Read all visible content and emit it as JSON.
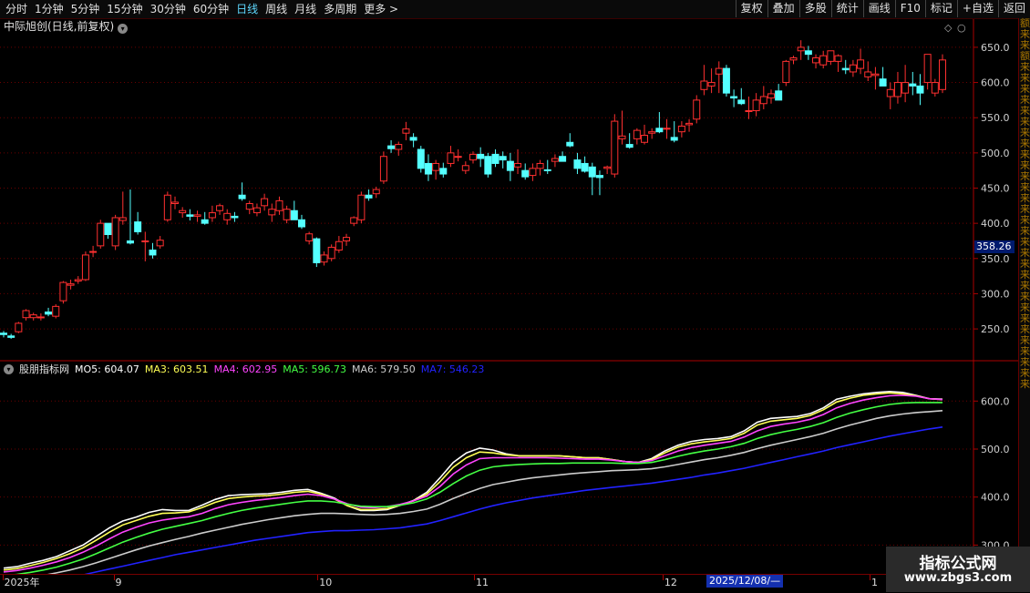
{
  "toolbar": {
    "periods": [
      "分时",
      "1分钟",
      "5分钟",
      "15分钟",
      "30分钟",
      "60分钟",
      "日线",
      "周线",
      "月线",
      "多周期",
      "更多 >"
    ],
    "active_period": "日线",
    "right_buttons": [
      "复权",
      "叠加",
      "多股",
      "统计",
      "画线",
      "F10",
      "标记",
      "+自选",
      "返回"
    ]
  },
  "chart_title": "中际旭创(日线,前复权)",
  "price_axis": {
    "ticks": [
      "650.0",
      "600.0",
      "550.0",
      "500.0",
      "450.0",
      "400.0",
      "350.0",
      "300.0",
      "250.0"
    ]
  },
  "current_price_label": "358.26",
  "indicator": {
    "name": "股朋指标网",
    "lines": [
      {
        "label": "MO5: 604.07",
        "color": "#ffffff"
      },
      {
        "label": "MA3: 603.51",
        "color": "#ffff55"
      },
      {
        "label": "MA4: 602.95",
        "color": "#ff44ff"
      },
      {
        "label": "MA5: 596.73",
        "color": "#44ff44"
      },
      {
        "label": "MA6: 579.50",
        "color": "#cccccc"
      },
      {
        "label": "MA7: 546.23",
        "color": "#2222ff"
      }
    ],
    "axis_ticks": [
      "600.0",
      "500.0",
      "400.0",
      "300.0"
    ],
    "axis_tick_values": [
      600,
      500,
      400,
      300
    ]
  },
  "side_strip_chars": [
    "额",
    "来",
    "来",
    "额",
    "来",
    "来",
    "来",
    "来",
    "来",
    "来",
    "来",
    "来",
    "来",
    "来",
    "来",
    "来",
    "来",
    "来",
    "来",
    "来",
    "来",
    "来",
    "来",
    "来",
    "来",
    "来",
    "来",
    "来",
    "来",
    "来",
    "来",
    "来",
    "来",
    "来"
  ],
  "date_axis": {
    "labels": [
      {
        "text": "2025年",
        "pos": 0.004
      },
      {
        "text": "9",
        "pos": 0.112
      },
      {
        "text": "10",
        "pos": 0.31
      },
      {
        "text": "11",
        "pos": 0.462
      },
      {
        "text": "12",
        "pos": 0.645
      },
      {
        "text": "1",
        "pos": 0.846
      }
    ],
    "selected_date": "2025/12/08/—"
  },
  "watermark": {
    "line1": "指标公式网",
    "line2": "www.zbgs3.com"
  },
  "colors": {
    "up": "#ff3030",
    "down": "#54ffff",
    "grid": "#6a0000",
    "axis": "#aa0000"
  },
  "chart_data": {
    "type": "candlestick",
    "y_range": [
      210,
      668
    ],
    "candles": [
      [
        244,
        247,
        238,
        242
      ],
      [
        240,
        243,
        236,
        238
      ],
      [
        246,
        260,
        244,
        258
      ],
      [
        266,
        278,
        262,
        276
      ],
      [
        266,
        273,
        262,
        270
      ],
      [
        266,
        272,
        262,
        267
      ],
      [
        274,
        280,
        268,
        271
      ],
      [
        268,
        285,
        265,
        282
      ],
      [
        290,
        318,
        286,
        316
      ],
      [
        312,
        320,
        306,
        314
      ],
      [
        318,
        325,
        314,
        320
      ],
      [
        320,
        360,
        318,
        355
      ],
      [
        360,
        368,
        352,
        360
      ],
      [
        368,
        405,
        364,
        400
      ],
      [
        400,
        390,
        378,
        384
      ],
      [
        368,
        412,
        362,
        408
      ],
      [
        404,
        445,
        398,
        408
      ],
      [
        375,
        448,
        370,
        372
      ],
      [
        402,
        416,
        384,
        388
      ],
      [
        375,
        388,
        346,
        375
      ],
      [
        362,
        372,
        350,
        355
      ],
      [
        368,
        382,
        364,
        376
      ],
      [
        405,
        445,
        402,
        440
      ],
      [
        428,
        438,
        420,
        430
      ],
      [
        415,
        423,
        408,
        418
      ],
      [
        412,
        420,
        404,
        410
      ],
      [
        410,
        418,
        402,
        412
      ],
      [
        405,
        416,
        398,
        400
      ],
      [
        408,
        425,
        402,
        415
      ],
      [
        418,
        428,
        412,
        425
      ],
      [
        405,
        420,
        398,
        414
      ],
      [
        410,
        416,
        402,
        408
      ],
      [
        440,
        458,
        432,
        435
      ],
      [
        420,
        432,
        413,
        428
      ],
      [
        415,
        428,
        410,
        422
      ],
      [
        425,
        442,
        418,
        435
      ],
      [
        412,
        428,
        402,
        420
      ],
      [
        418,
        438,
        412,
        432
      ],
      [
        405,
        425,
        400,
        420
      ],
      [
        418,
        432,
        410,
        405
      ],
      [
        405,
        412,
        392,
        395
      ],
      [
        375,
        388,
        370,
        385
      ],
      [
        378,
        380,
        338,
        344
      ],
      [
        345,
        360,
        340,
        355
      ],
      [
        350,
        370,
        346,
        366
      ],
      [
        362,
        382,
        358,
        374
      ],
      [
        375,
        385,
        368,
        380
      ],
      [
        400,
        410,
        396,
        408
      ],
      [
        405,
        445,
        400,
        440
      ],
      [
        440,
        448,
        432,
        436
      ],
      [
        442,
        452,
        436,
        448
      ],
      [
        460,
        502,
        456,
        495
      ],
      [
        510,
        518,
        500,
        506
      ],
      [
        505,
        516,
        496,
        512
      ],
      [
        528,
        544,
        518,
        534
      ],
      [
        522,
        528,
        508,
        518
      ],
      [
        505,
        510,
        472,
        478
      ],
      [
        485,
        498,
        460,
        470
      ],
      [
        475,
        490,
        462,
        485
      ],
      [
        478,
        486,
        465,
        470
      ],
      [
        485,
        510,
        480,
        500
      ],
      [
        495,
        505,
        488,
        495
      ],
      [
        475,
        488,
        470,
        482
      ],
      [
        490,
        502,
        485,
        498
      ],
      [
        498,
        508,
        480,
        492
      ],
      [
        495,
        500,
        465,
        470
      ],
      [
        498,
        505,
        480,
        485
      ],
      [
        495,
        502,
        478,
        490
      ],
      [
        488,
        500,
        460,
        475
      ],
      [
        480,
        505,
        470,
        485
      ],
      [
        475,
        485,
        462,
        466
      ],
      [
        468,
        485,
        460,
        478
      ],
      [
        478,
        490,
        468,
        485
      ],
      [
        476,
        490,
        470,
        475
      ],
      [
        488,
        498,
        480,
        492
      ],
      [
        495,
        502,
        488,
        488
      ],
      [
        515,
        528,
        508,
        510
      ],
      [
        490,
        500,
        470,
        478
      ],
      [
        485,
        495,
        472,
        474
      ],
      [
        480,
        486,
        440,
        466
      ],
      [
        468,
        475,
        440,
        465
      ],
      [
        478,
        482,
        470,
        480
      ],
      [
        470,
        555,
        465,
        545
      ],
      [
        520,
        560,
        512,
        524
      ],
      [
        512,
        528,
        506,
        508
      ],
      [
        520,
        535,
        512,
        532
      ],
      [
        515,
        540,
        512,
        525
      ],
      [
        528,
        535,
        520,
        530
      ],
      [
        535,
        558,
        528,
        530
      ],
      [
        535,
        548,
        520,
        535
      ],
      [
        522,
        545,
        515,
        518
      ],
      [
        530,
        545,
        522,
        538
      ],
      [
        540,
        548,
        530,
        542
      ],
      [
        548,
        582,
        542,
        575
      ],
      [
        590,
        625,
        582,
        602
      ],
      [
        595,
        620,
        585,
        600
      ],
      [
        612,
        630,
        585,
        620
      ],
      [
        620,
        625,
        580,
        585
      ],
      [
        580,
        590,
        565,
        578
      ],
      [
        575,
        592,
        568,
        570
      ],
      [
        560,
        580,
        548,
        560
      ],
      [
        560,
        585,
        552,
        575
      ],
      [
        570,
        595,
        562,
        580
      ],
      [
        578,
        590,
        570,
        584
      ],
      [
        588,
        598,
        580,
        575
      ],
      [
        600,
        632,
        595,
        630
      ],
      [
        632,
        638,
        626,
        635
      ],
      [
        645,
        660,
        632,
        650
      ],
      [
        645,
        652,
        632,
        640
      ],
      [
        628,
        640,
        620,
        635
      ],
      [
        625,
        645,
        620,
        638
      ],
      [
        630,
        645,
        625,
        645
      ],
      [
        630,
        640,
        615,
        638
      ],
      [
        620,
        632,
        612,
        618
      ],
      [
        615,
        632,
        608,
        625
      ],
      [
        620,
        648,
        612,
        632
      ],
      [
        608,
        630,
        602,
        615
      ],
      [
        610,
        622,
        590,
        612
      ],
      [
        605,
        622,
        595,
        595
      ],
      [
        580,
        600,
        562,
        590
      ],
      [
        580,
        615,
        570,
        600
      ],
      [
        585,
        625,
        572,
        600
      ],
      [
        598,
        615,
        582,
        595
      ],
      [
        595,
        612,
        568,
        585
      ],
      [
        600,
        638,
        590,
        640
      ],
      [
        585,
        605,
        580,
        600
      ],
      [
        590,
        640,
        585,
        632
      ]
    ],
    "indicator_y_range": [
      240,
      648
    ],
    "series": [
      {
        "name": "MO5",
        "color": "#ffffff",
        "values": [
          252,
          255,
          262,
          268,
          276,
          288,
          300,
          318,
          336,
          350,
          358,
          368,
          374,
          372,
          372,
          383,
          395,
          403,
          405,
          406,
          407,
          410,
          414,
          416,
          408,
          398,
          382,
          372,
          372,
          374,
          383,
          393,
          410,
          440,
          472,
          492,
          502,
          498,
          490,
          486,
          486,
          486,
          486,
          484,
          482,
          482,
          478,
          474,
          472,
          480,
          496,
          508,
          516,
          520,
          522,
          526,
          538,
          556,
          564,
          566,
          568,
          574,
          586,
          604,
          610,
          615,
          618,
          620,
          618,
          612,
          605,
          604
        ]
      },
      {
        "name": "MA3",
        "color": "#ffff55",
        "values": [
          248,
          251,
          257,
          264,
          272,
          282,
          294,
          310,
          327,
          342,
          351,
          360,
          366,
          367,
          369,
          378,
          389,
          397,
          400,
          402,
          403,
          406,
          410,
          412,
          406,
          396,
          382,
          374,
          374,
          376,
          383,
          392,
          406,
          432,
          462,
          482,
          494,
          492,
          488,
          486,
          486,
          486,
          486,
          484,
          482,
          482,
          478,
          474,
          472,
          478,
          492,
          504,
          511,
          515,
          518,
          522,
          533,
          550,
          558,
          561,
          564,
          570,
          582,
          598,
          606,
          612,
          615,
          617,
          615,
          611,
          605,
          603
        ]
      },
      {
        "name": "MA4",
        "color": "#ff44ff",
        "values": [
          244,
          247,
          252,
          258,
          265,
          274,
          285,
          298,
          313,
          327,
          337,
          346,
          352,
          356,
          359,
          366,
          376,
          384,
          389,
          393,
          396,
          399,
          403,
          406,
          403,
          396,
          386,
          379,
          378,
          380,
          385,
          392,
          402,
          422,
          448,
          467,
          480,
          482,
          482,
          482,
          482,
          482,
          481,
          480,
          479,
          479,
          477,
          474,
          472,
          476,
          486,
          496,
          503,
          508,
          512,
          516,
          525,
          538,
          547,
          552,
          556,
          562,
          572,
          586,
          595,
          602,
          607,
          611,
          612,
          610,
          605,
          603
        ]
      },
      {
        "name": "MA5",
        "color": "#44ff44",
        "values": [
          236,
          239,
          243,
          248,
          254,
          262,
          271,
          282,
          294,
          306,
          316,
          325,
          333,
          339,
          345,
          351,
          359,
          366,
          372,
          377,
          381,
          385,
          389,
          392,
          392,
          390,
          385,
          381,
          380,
          380,
          383,
          388,
          396,
          410,
          428,
          444,
          456,
          463,
          466,
          468,
          469,
          470,
          470,
          471,
          471,
          471,
          471,
          470,
          470,
          472,
          478,
          485,
          491,
          496,
          500,
          505,
          512,
          522,
          530,
          536,
          541,
          547,
          555,
          566,
          575,
          582,
          588,
          593,
          596,
          597,
          597,
          597
        ]
      },
      {
        "name": "MA6",
        "color": "#cccccc",
        "values": [
          228,
          230,
          233,
          237,
          242,
          248,
          255,
          263,
          272,
          281,
          290,
          298,
          305,
          312,
          318,
          325,
          331,
          337,
          343,
          348,
          353,
          357,
          361,
          364,
          366,
          366,
          365,
          364,
          363,
          364,
          366,
          370,
          375,
          385,
          397,
          408,
          418,
          426,
          431,
          436,
          440,
          443,
          446,
          449,
          451,
          453,
          455,
          456,
          457,
          459,
          463,
          468,
          473,
          478,
          482,
          487,
          493,
          501,
          508,
          514,
          520,
          526,
          533,
          542,
          550,
          557,
          564,
          569,
          573,
          576,
          578,
          580
        ]
      },
      {
        "name": "MA7",
        "color": "#2222ff",
        "values": [
          218,
          220,
          222,
          225,
          229,
          233,
          238,
          244,
          250,
          256,
          262,
          268,
          274,
          280,
          285,
          290,
          295,
          300,
          305,
          310,
          314,
          318,
          322,
          326,
          328,
          330,
          330,
          331,
          332,
          334,
          336,
          340,
          344,
          351,
          359,
          367,
          375,
          382,
          388,
          393,
          398,
          402,
          406,
          410,
          414,
          417,
          420,
          423,
          426,
          429,
          433,
          437,
          441,
          446,
          450,
          455,
          460,
          466,
          472,
          478,
          484,
          490,
          496,
          503,
          509,
          515,
          521,
          527,
          532,
          537,
          542,
          546
        ]
      }
    ]
  }
}
